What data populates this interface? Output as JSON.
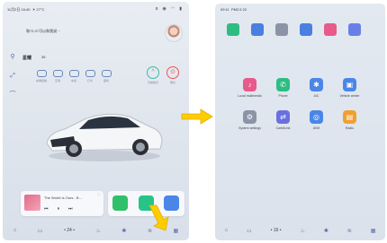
{
  "left_screen": {
    "status": {
      "datetime": "11月2日 16:40",
      "weather": "☀ 27°C",
      "icons": [
        "bluetooth-icon",
        "location-icon",
        "wifi-icon",
        "signal-icon"
      ]
    },
    "voice_hint": "和\"G.G\"可以和我说···",
    "car": {
      "model": "星耀",
      "range": "35"
    },
    "controls": [
      {
        "label": "车辆控制",
        "icon": "car-control-icon"
      },
      {
        "label": "空调",
        "icon": "ac-icon"
      },
      {
        "label": "车窗",
        "icon": "window-icon"
      },
      {
        "label": "灯光",
        "icon": "light-icon"
      },
      {
        "label": "座椅",
        "icon": "seat-icon"
      }
    ],
    "modes": [
      {
        "label": "驾驶模式",
        "icon": "drive-mode-icon",
        "color": "#3fb8a8"
      },
      {
        "label": "哨兵",
        "icon": "sentry-icon",
        "color": "#e85656"
      }
    ],
    "music": {
      "title": "The World Is Ours - B..."
    },
    "apps": [
      {
        "icon": "wechat-icon",
        "color": "#2fc06a"
      },
      {
        "icon": "phone-app-icon",
        "color": "#26c486"
      },
      {
        "icon": "car-app-icon",
        "color": "#4a86e8"
      }
    ],
    "dock": {
      "temp": "24"
    }
  },
  "right_screen": {
    "status": {
      "time": "09:11",
      "weather": "PM2.5 22"
    },
    "top_apps": [
      {
        "icon": "phone-icon",
        "color": "#2dbd82"
      },
      {
        "icon": "bus-icon",
        "color": "#4a7fe0"
      },
      {
        "icon": "gear-icon",
        "color": "#8a94a6"
      },
      {
        "icon": "gallery-icon",
        "color": "#4a7fe0"
      },
      {
        "icon": "message-icon",
        "color": "#e85a8a"
      },
      {
        "icon": "settings-app-icon",
        "color": "#6a7fe6"
      }
    ],
    "apps": [
      {
        "label": "Local multimedia",
        "icon": "music-note-icon",
        "color": "#e85a8a"
      },
      {
        "label": "Phone",
        "icon": "phone-icon",
        "color": "#2dbd82"
      },
      {
        "label": "A/C",
        "icon": "fan-icon",
        "color": "#4a86e8"
      },
      {
        "label": "Vehicle center",
        "icon": "car-icon",
        "color": "#4a86e8"
      },
      {
        "label": "System settings",
        "icon": "gear-icon",
        "color": "#8a94a6"
      },
      {
        "label": "CarbitLink",
        "icon": "link-icon",
        "color": "#6a6fe0"
      },
      {
        "label": "AVM",
        "icon": "camera-icon",
        "color": "#4a86e8"
      },
      {
        "label": "Radio",
        "icon": "radio-icon",
        "color": "#f0a030"
      }
    ],
    "dock": {
      "temp": "16"
    }
  },
  "accent_color": "#ffcc00"
}
